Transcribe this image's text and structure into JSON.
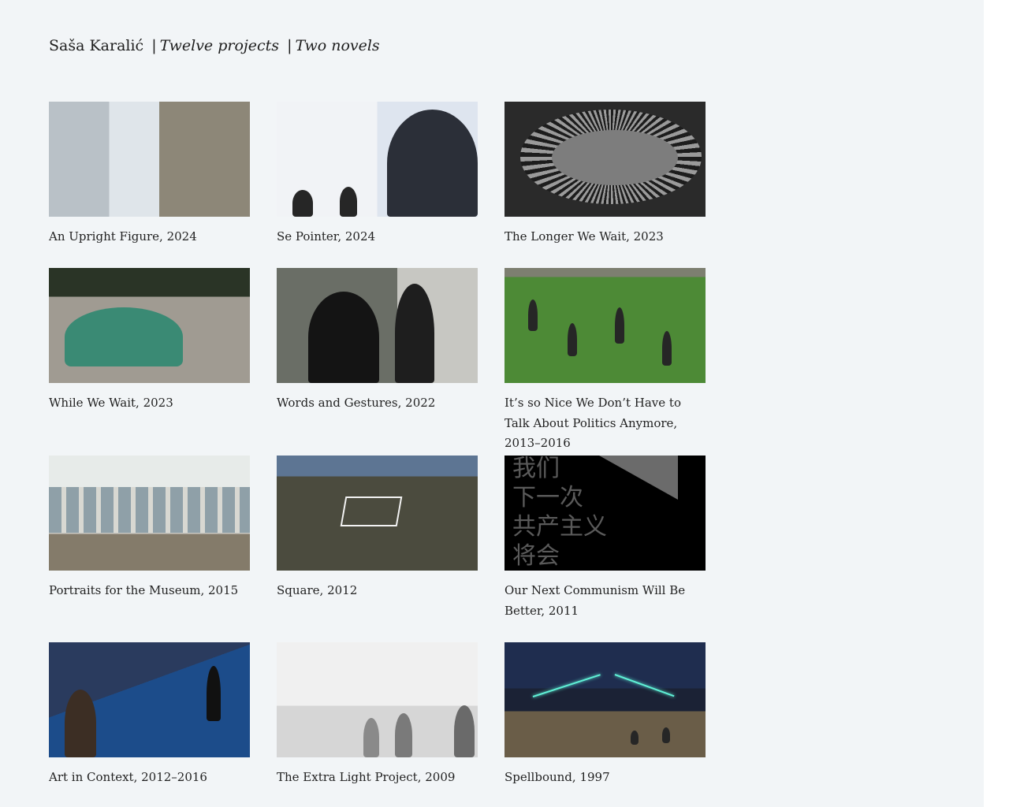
{
  "header": {
    "author": "Saša Karalić",
    "separator": "|",
    "link_projects": "Twelve projects",
    "link_novels": "Two novels"
  },
  "thumb_texts": {
    "communism_chars": "我们\n下一次\n共产主义\n将会"
  },
  "projects": [
    {
      "title": "An Upright Figure, 2024"
    },
    {
      "title": "Se Pointer, 2024"
    },
    {
      "title": "The Longer We Wait, 2023"
    },
    {
      "title": "While We Wait, 2023"
    },
    {
      "title": "Words and Gestures, 2022"
    },
    {
      "title": "It’s so Nice We Don’t Have to Talk About Politics Anymore, 2013–2016"
    },
    {
      "title": "Portraits for the Museum, 2015"
    },
    {
      "title": "Square, 2012"
    },
    {
      "title": "Our Next Communism Will Be Better, 2011"
    },
    {
      "title": "Art in Context, 2012–2016"
    },
    {
      "title": "The Extra Light Project, 2009"
    },
    {
      "title": "Spellbound, 1997"
    }
  ]
}
